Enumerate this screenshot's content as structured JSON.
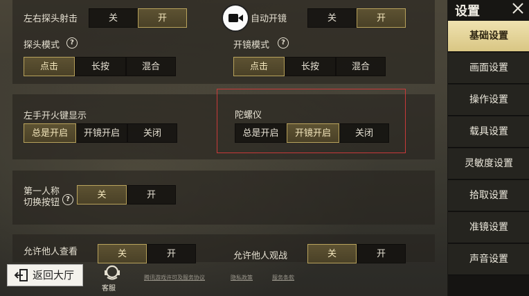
{
  "sidebar": {
    "title": "设置",
    "items": [
      {
        "label": "基础设置",
        "active": true
      },
      {
        "label": "画面设置",
        "active": false
      },
      {
        "label": "操作设置",
        "active": false
      },
      {
        "label": "载具设置",
        "active": false
      },
      {
        "label": "灵敏度设置",
        "active": false
      },
      {
        "label": "拾取设置",
        "active": false
      },
      {
        "label": "准镜设置",
        "active": false
      },
      {
        "label": "声音设置",
        "active": false
      }
    ]
  },
  "settings": {
    "peek_fire": {
      "label": "左右探头射击",
      "options": [
        "关",
        "开"
      ],
      "selected": 1
    },
    "auto_scope": {
      "label": "自动开镜",
      "options": [
        "关",
        "开"
      ],
      "selected": 1
    },
    "peek_mode": {
      "label": "探头模式",
      "options": [
        "点击",
        "长按",
        "混合"
      ],
      "selected": 0
    },
    "scope_mode": {
      "label": "开镜模式",
      "options": [
        "点击",
        "长按",
        "混合"
      ],
      "selected": 0
    },
    "left_fire": {
      "label": "左手开火键显示",
      "options": [
        "总是开启",
        "开镜开启",
        "关闭"
      ],
      "selected": 0
    },
    "gyroscope": {
      "label": "陀螺仪",
      "options": [
        "总是开启",
        "开镜开启",
        "关闭"
      ],
      "selected": 1
    },
    "first_person": {
      "label_line1": "第一人称",
      "label_line2": "切换按钮",
      "options": [
        "关",
        "开"
      ],
      "selected": 0
    },
    "allow_view": {
      "label": "允许他人查看",
      "options": [
        "关",
        "开"
      ],
      "selected": 0
    },
    "allow_watch": {
      "label": "允许他人观战",
      "options": [
        "关",
        "开"
      ],
      "selected": 0
    }
  },
  "bottom": {
    "back_label": "返回大厅",
    "service_label": "客服",
    "links": [
      "腾讯游戏许可及服务协议",
      "隐私政策",
      "服务条款"
    ]
  }
}
